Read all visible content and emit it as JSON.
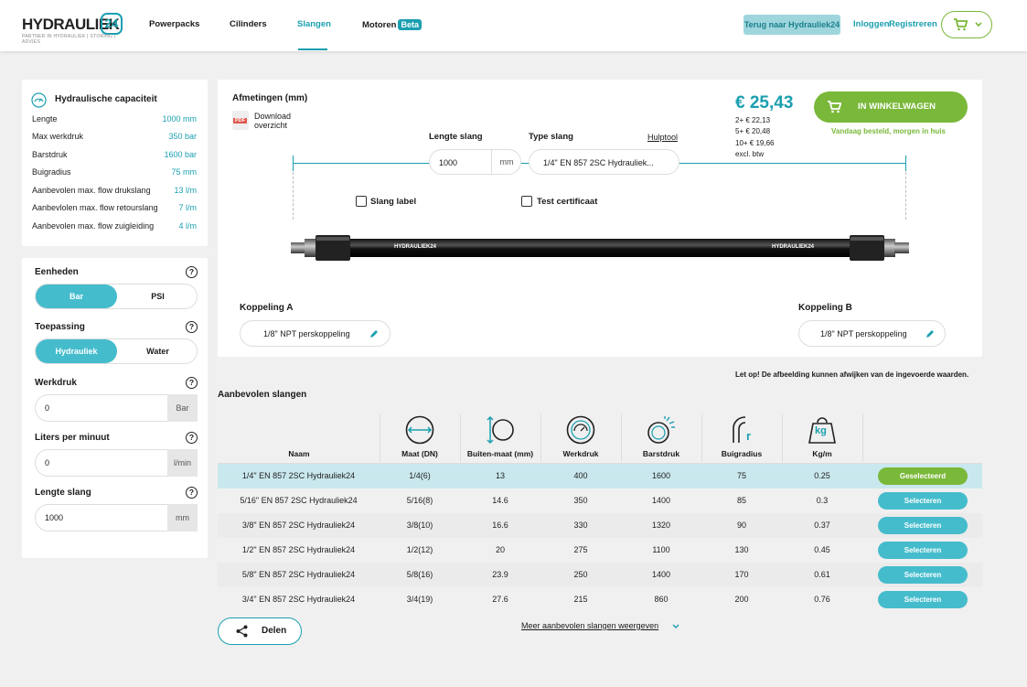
{
  "header": {
    "logo_text": "HYDRAULIEK",
    "logo_badge": "24",
    "logo_tagline": "PARTNER IN HYDRAULIEK | STORING | ADVIES",
    "nav": [
      {
        "label": "Powerpacks",
        "active": false
      },
      {
        "label": "Cilinders",
        "active": false
      },
      {
        "label": "Slangen",
        "active": true
      },
      {
        "label": "Motoren",
        "active": false,
        "badge": "Beta"
      }
    ],
    "back_button": "Terug naar Hydrauliek24",
    "login": "Inloggen",
    "register": "Registreren",
    "cart_icon": "cart-icon"
  },
  "capacity": {
    "title": "Hydraulische capaciteit",
    "rows": [
      {
        "label": "Lengte",
        "value": "1000 mm"
      },
      {
        "label": "Max werkdruk",
        "value": "350 bar"
      },
      {
        "label": "Barstdruk",
        "value": "1600 bar"
      },
      {
        "label": "Buigradius",
        "value": "75 mm"
      },
      {
        "label": "Aanbevolen max. flow drukslang",
        "value": "13 l/m"
      },
      {
        "label": "Aanbevlolen max. flow retourslang",
        "value": "7 l/m"
      },
      {
        "label": "Aanbevolen max. flow zuigleiding",
        "value": "4 l/m"
      }
    ]
  },
  "settings": {
    "units": {
      "label": "Eenheden",
      "options": [
        "Bar",
        "PSI"
      ],
      "selected": "Bar"
    },
    "application": {
      "label": "Toepassing",
      "options": [
        "Hydrauliek",
        "Water"
      ],
      "selected": "Hydrauliek"
    },
    "pressure": {
      "label": "Werkdruk",
      "value": "0",
      "unit": "Bar"
    },
    "flow": {
      "label": "Liters per minuut",
      "value": "0",
      "unit": "l/min"
    },
    "length": {
      "label": "Lengte slang",
      "value": "1000",
      "unit": "mm"
    },
    "help": "?"
  },
  "config": {
    "dimensions_title": "Afmetingen (mm)",
    "download_label": "Download\noverzicht",
    "pdf_label": "PDF",
    "hose_length_label": "Lengte slang",
    "hose_length_value": "1000",
    "hose_length_unit": "mm",
    "hose_type_label": "Type slang",
    "hose_type_value": "1/4\" EN 857 2SC Hydrauliek...",
    "help_tool": "Hulptool",
    "option_label": "Slang label",
    "option_cert": "Test certificaat",
    "coupling_a_label": "Koppeling A",
    "coupling_a_value": "1/8\" NPT perskoppeling",
    "coupling_b_label": "Koppeling B",
    "coupling_b_value": "1/8\" NPT perskoppeling",
    "hose_print": "HYDRAULIEK24"
  },
  "pricing": {
    "price": "€ 25,43",
    "tiers": [
      "2+ € 22,13",
      "5+ € 20,48",
      "10+ € 19,66",
      "excl. btw"
    ],
    "cart_button": "IN WINKELWAGEN",
    "delivery": "Vandaag besteld, morgen in huis"
  },
  "disclaimer": "Let op! De afbeelding kunnen afwijken van de ingevoerde waarden.",
  "recommended": {
    "title": "Aanbevolen slangen",
    "columns": [
      "Naam",
      "Maat (DN)",
      "Buiten-maat (mm)",
      "Werkdruk",
      "Barstdruk",
      "Buigradius",
      "Kg/m"
    ],
    "column_icons": [
      "diameter-icon",
      "outer-diameter-icon",
      "pressure-gauge-icon",
      "burst-pressure-icon",
      "bend-radius-icon",
      "weight-icon"
    ],
    "rows": [
      {
        "name": "1/4\" EN 857 2SC Hydrauliek24",
        "dn": "1/4(6)",
        "od": "13",
        "wp": "400",
        "bp": "1600",
        "br": "75",
        "kg": "0.25",
        "action": "Geselecteerd"
      },
      {
        "name": "5/16\" EN 857 2SC Hydrauliek24",
        "dn": "5/16(8)",
        "od": "14.6",
        "wp": "350",
        "bp": "1400",
        "br": "85",
        "kg": "0.3",
        "action": "Selecteren"
      },
      {
        "name": "3/8\" EN 857 2SC Hydrauliek24",
        "dn": "3/8(10)",
        "od": "16.6",
        "wp": "330",
        "bp": "1320",
        "br": "90",
        "kg": "0.37",
        "action": "Selecteren"
      },
      {
        "name": "1/2\" EN 857 2SC Hydrauliek24",
        "dn": "1/2(12)",
        "od": "20",
        "wp": "275",
        "bp": "1100",
        "br": "130",
        "kg": "0.45",
        "action": "Selecteren"
      },
      {
        "name": "5/8\" EN 857 2SC Hydrauliek24",
        "dn": "5/8(16)",
        "od": "23.9",
        "wp": "250",
        "bp": "1400",
        "br": "170",
        "kg": "0.61",
        "action": "Selecteren"
      },
      {
        "name": "3/4\" EN 857 2SC Hydrauliek24",
        "dn": "3/4(19)",
        "od": "27.6",
        "wp": "215",
        "bp": "860",
        "br": "200",
        "kg": "0.76",
        "action": "Selecteren"
      }
    ],
    "more": "Meer aanbevolen slangen weergeven",
    "share": "Delen",
    "kg_icon_text": "kg",
    "r_icon_text": "r"
  },
  "colors": {
    "accent": "#1a9fb0",
    "green": "#7ab83a",
    "selected_row": "#c9e8ee"
  }
}
